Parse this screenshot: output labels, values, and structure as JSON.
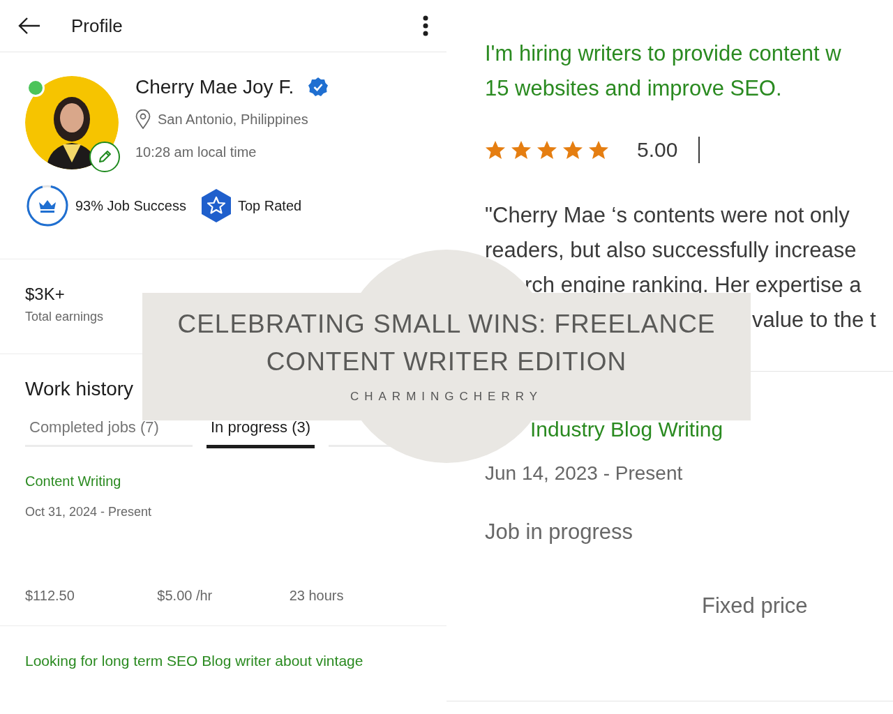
{
  "profile_header": {
    "title": "Profile"
  },
  "profile": {
    "name": "Cherry Mae Joy F.",
    "verified": true,
    "online": true,
    "location": "San Antonio, Philippines",
    "local_time": "10:28 am local time",
    "badges": [
      {
        "kind": "job_success",
        "label": "93% Job Success",
        "level": 0.93
      },
      {
        "kind": "top_rated",
        "label": "Top Rated"
      }
    ]
  },
  "stats": [
    {
      "value": "$3K+",
      "label": "Total earnings"
    }
  ],
  "work_history": {
    "title": "Work history",
    "tabs": [
      {
        "label": "Completed jobs (7)",
        "selected": false
      },
      {
        "label": "In progress (3)",
        "selected": true
      }
    ],
    "jobs": [
      {
        "title": "Content Writing",
        "dates": "Oct 31, 2024 - Present",
        "earned": "$112.50",
        "rate": "$5.00 /hr",
        "hours": "23 hours"
      },
      {
        "title": "Looking for long term SEO Blog writer about vintage"
      }
    ]
  },
  "review_panel": {
    "job_description_lines": [
      "I'm hiring writers to provide content w",
      "15 websites and improve SEO."
    ],
    "stars": 5,
    "rating": "5.00",
    "review_lines": [
      "\"Cherry Mae ‘s contents were not only",
      "readers, but also successfully increase",
      "rch engine ranking. Her expertise a",
      "value to the t"
    ],
    "job": {
      "title": "Industry Blog Writing",
      "dates": "Jun 14, 2023 - Present",
      "status": "Job in progress",
      "pricing": "Fixed price"
    }
  },
  "banner": {
    "title": "CELEBRATING SMALL WINS: FREELANCE CONTENT WRITER EDITION",
    "byline": "CHARMINGCHERRY"
  }
}
